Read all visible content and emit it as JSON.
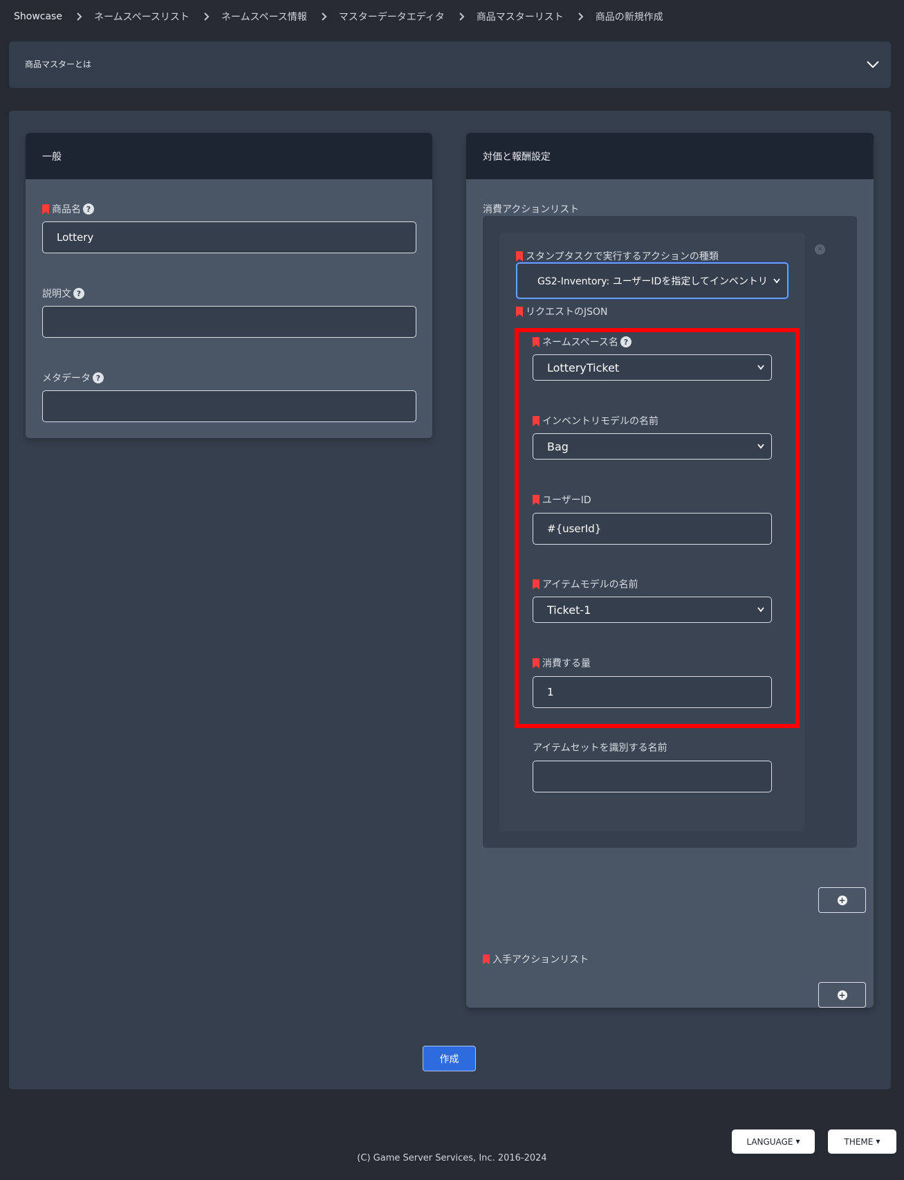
{
  "breadcrumb": [
    "Showcase",
    "ネームスペースリスト",
    "ネームスペース情報",
    "マスターデータエディタ",
    "商品マスターリスト",
    "商品の新規作成"
  ],
  "about": {
    "title": "商品マスターとは"
  },
  "general": {
    "title": "一般",
    "name_label": "商品名",
    "name_value": "Lottery",
    "description_label": "説明文",
    "description_value": "",
    "metadata_label": "メタデータ",
    "metadata_value": ""
  },
  "reward": {
    "title": "対価と報酬設定",
    "consume_list_label": "消費アクションリスト",
    "action": {
      "type_label": "スタンプタスクで実行するアクションの種類",
      "type_value": "GS2-Inventory: ユーザーIDを指定してインベントリ",
      "request_json_label": "リクエストのJSON",
      "namespace_label": "ネームスペース名",
      "namespace_value": "LotteryTicket",
      "inventory_label": "インベントリモデルの名前",
      "inventory_value": "Bag",
      "user_id_label": "ユーザーID",
      "user_id_value": "#{userId}",
      "item_label": "アイテムモデルの名前",
      "item_value": "Ticket-1",
      "consume_count_label": "消費する量",
      "consume_count_value": "1",
      "item_set_label": "アイテムセットを識別する名前",
      "item_set_value": ""
    },
    "acquire_list_label": "入手アクションリスト"
  },
  "submit_label": "作成",
  "footer": {
    "language_label": "LANGUAGE",
    "theme_label": "THEME",
    "copyright": "(C) Game Server Services, Inc. 2016-2024"
  },
  "icons": {
    "required": "bookmark-icon",
    "help": "question-circle-icon",
    "add": "plus-circle-icon",
    "remove": "x-circle-icon",
    "expand": "chevron-down-icon"
  },
  "colors": {
    "accent": "#2e6bdf",
    "required": "#ff3b3b",
    "highlight_box": "#ff0000"
  }
}
